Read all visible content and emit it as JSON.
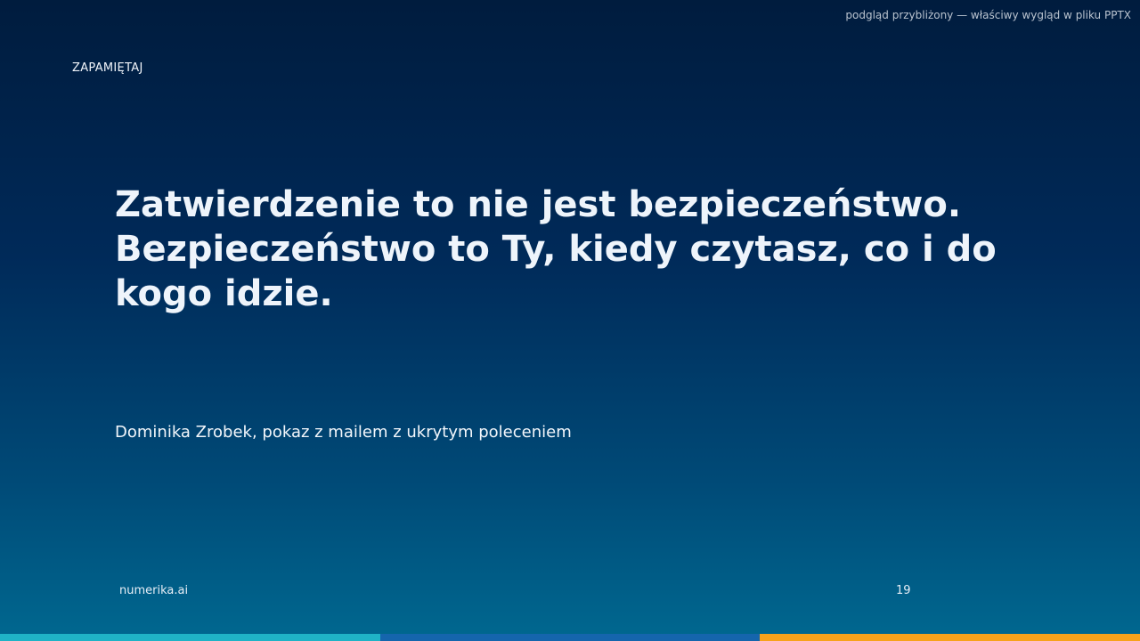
{
  "preview_note": "podgląd przybliżony — właściwy wygląd w pliku PPTX",
  "slide": {
    "eyebrow": "ZAPAMIĘTAJ",
    "headline": "Zatwierdzenie to nie jest bezpieczeństwo. Bezpieczeństwo to Ty, kiedy czytasz, co i do kogo idzie.",
    "subline": "Dominika Zrobek, pokaz z mailem z ukrytym poleceniem"
  },
  "footer": {
    "brand": "numerika.ai",
    "page_number": "19"
  },
  "colors": {
    "background_top": "#001c3e",
    "background_bottom": "#006890",
    "accent_bar": [
      "#1fb3c6",
      "#1565ad",
      "#f7a21b"
    ]
  }
}
